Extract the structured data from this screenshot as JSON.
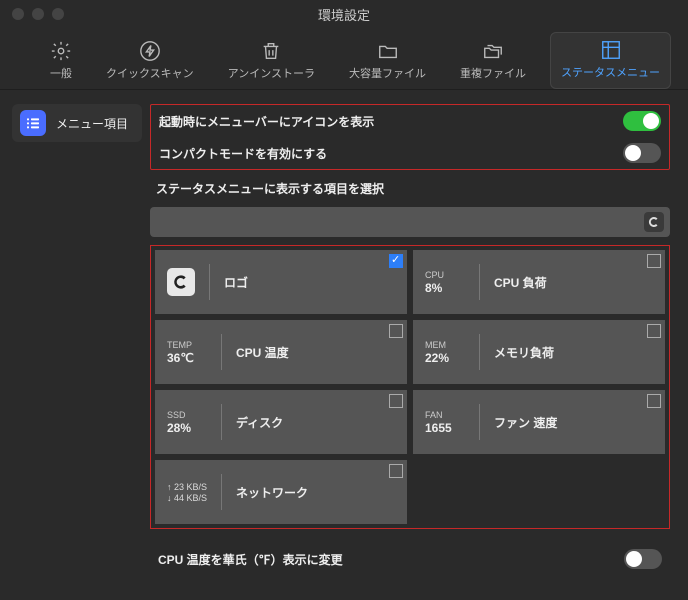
{
  "window": {
    "title": "環境設定"
  },
  "tabs": [
    {
      "id": "general",
      "label": "一般"
    },
    {
      "id": "quick",
      "label": "クイックスキャン"
    },
    {
      "id": "uninstall",
      "label": "アンインストーラ"
    },
    {
      "id": "large",
      "label": "大容量ファイル"
    },
    {
      "id": "dup",
      "label": "重複ファイル"
    },
    {
      "id": "status",
      "label": "ステータスメニュー"
    }
  ],
  "sidebar": {
    "item_label": "メニュー項目"
  },
  "settings": {
    "startup_icon_label": "起動時にメニューバーにアイコンを表示",
    "startup_icon_on": true,
    "compact_label": "コンパクトモードを有効にする",
    "compact_on": false,
    "select_heading": "ステータスメニューに表示する項目を選択",
    "fahrenheit_label": "CPU 温度を華氏（℉）表示に変更",
    "fahrenheit_on": false
  },
  "cards": {
    "logo": {
      "title": "ロゴ",
      "checked": true
    },
    "cpu": {
      "metric_label": "CPU",
      "metric_value": "8%",
      "title": "CPU 負荷",
      "checked": false
    },
    "temp": {
      "metric_label": "TEMP",
      "metric_value": "36℃",
      "title": "CPU 温度",
      "checked": false
    },
    "mem": {
      "metric_label": "MEM",
      "metric_value": "22%",
      "title": "メモリ負荷",
      "checked": false
    },
    "ssd": {
      "metric_label": "SSD",
      "metric_value": "28%",
      "title": "ディスク",
      "checked": false
    },
    "fan": {
      "metric_label": "FAN",
      "metric_value": "1655",
      "title": "ファン 速度",
      "checked": false
    },
    "net": {
      "up": "↑ 23 KB/S",
      "down": "↓ 44 KB/S",
      "title": "ネットワーク",
      "checked": false
    }
  }
}
